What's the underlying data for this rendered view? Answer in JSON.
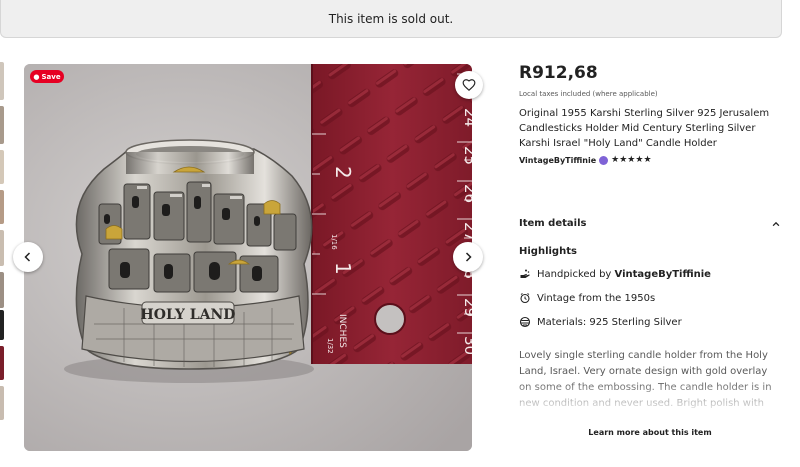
{
  "banner": {
    "text": "This item is sold out."
  },
  "gallery": {
    "save_label": "Save",
    "thumbnail_colors": [
      "#cfc6bb",
      "#a89a8c",
      "#d4c8b8",
      "#b59b86",
      "#c9bdb0",
      "#9c8f84",
      "#222222",
      "#7a1e2a",
      "#c8bcb0"
    ]
  },
  "listing": {
    "price": "R912,68",
    "tax_note": "Local taxes included (where applicable)",
    "title": "Original 1955 Karshi Sterling Silver 925 Jerusalem Candlesticks Holder Mid Century Sterling Silver Karshi Israel \"Holy Land\" Candle Holder",
    "shop_name": "VintageByTiffinie",
    "rating_stars": "★★★★★",
    "star_rating": 5
  },
  "item_details": {
    "heading": "Item details",
    "highlights_heading": "Highlights",
    "highlights": {
      "handpicked_prefix": "Handpicked by ",
      "handpicked_shop": "VintageByTiffinie",
      "vintage": "Vintage from the 1950s",
      "materials": "Materials: 925 Sterling Silver"
    },
    "description": "Lovely single sterling candle holder from the Holy Land, Israel. Very ornate design with gold overlay on some of the embossing. The candle holder is in new condition and never used. Bright polish with the dated",
    "learn_more": "Learn more about this item"
  },
  "photo": {
    "engraving": "HOLY LAND",
    "ruler_numbers": [
      "24",
      "25",
      "26",
      "27",
      "28",
      "29",
      "30"
    ],
    "ruler_inch_marks": [
      "2",
      "1"
    ],
    "ruler_unit": "INCHES",
    "ruler_fractions": [
      "1/16",
      "1/32"
    ],
    "colors": {
      "ruler": "#8c1f2f",
      "silver": "#c9c6c0",
      "gold": "#c9a53a",
      "background": "#b9b5b5"
    }
  }
}
